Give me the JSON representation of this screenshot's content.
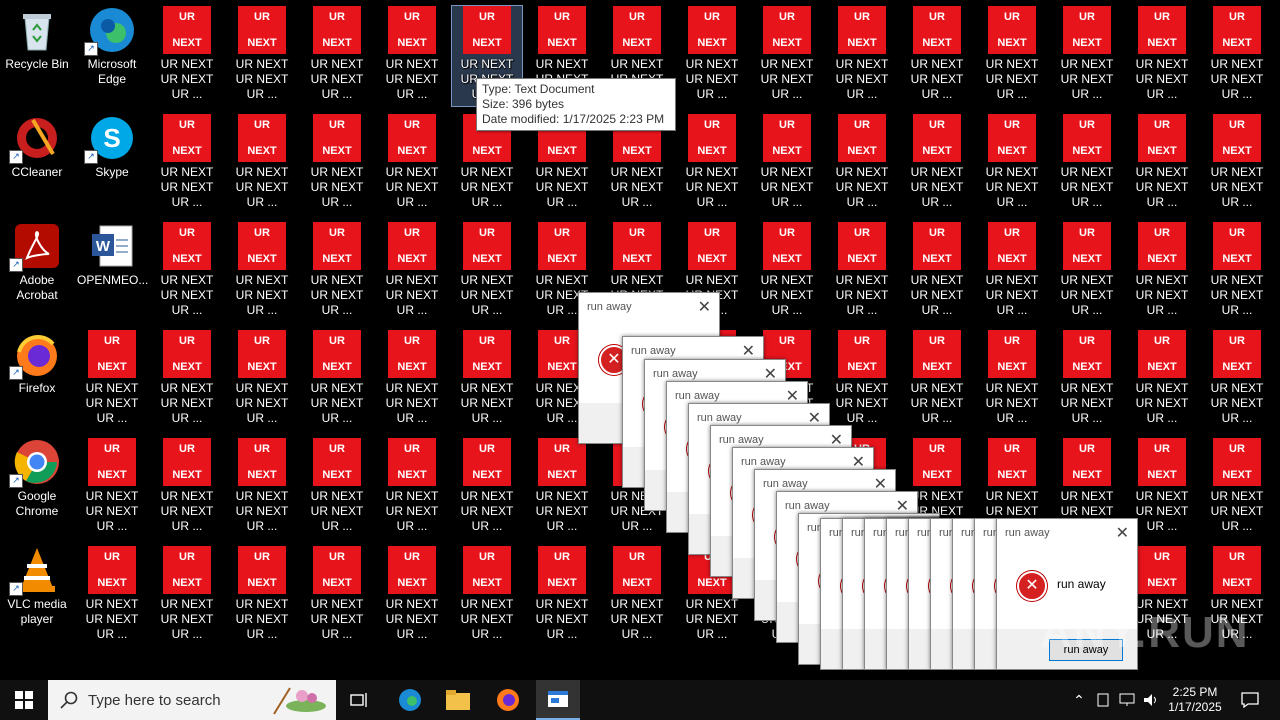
{
  "desktop": {
    "system_icons": [
      {
        "label": "Recycle Bin",
        "icon": "recycle-bin-icon",
        "shortcut": false
      },
      {
        "label": "CCleaner",
        "icon": "ccleaner-icon",
        "shortcut": true
      },
      {
        "label": "Adobe Acrobat",
        "icon": "adobe-acrobat-icon",
        "shortcut": true
      },
      {
        "label": "Firefox",
        "icon": "firefox-icon",
        "shortcut": true
      },
      {
        "label": "Google Chrome",
        "icon": "chrome-icon",
        "shortcut": true
      },
      {
        "label": "VLC media player",
        "icon": "vlc-icon",
        "shortcut": true
      }
    ],
    "second_column": [
      {
        "label": "Microsoft Edge",
        "icon": "edge-icon",
        "shortcut": true
      },
      {
        "label": "Skype",
        "icon": "skype-icon",
        "shortcut": true
      },
      {
        "label": "OPENMEO...",
        "icon": "word-document-icon",
        "shortcut": false
      }
    ],
    "tile": {
      "top": "UR",
      "bottom": "NEXT",
      "label": "UR NEXT UR NEXT UR ..."
    },
    "colors": {
      "tile": "#e8141c",
      "desktop": "#000000"
    }
  },
  "tooltip": {
    "type": "Type: Text Document",
    "size": "Size: 396 bytes",
    "date": "Date modified: 1/17/2025 2:23 PM"
  },
  "dialog": {
    "title": "run away",
    "message": "run away",
    "button": "run away",
    "close": "✕"
  },
  "taskbar": {
    "search_placeholder": "Type here to search",
    "time": "2:25 PM",
    "date": "1/17/2025"
  },
  "watermark": "ANY.RUN"
}
